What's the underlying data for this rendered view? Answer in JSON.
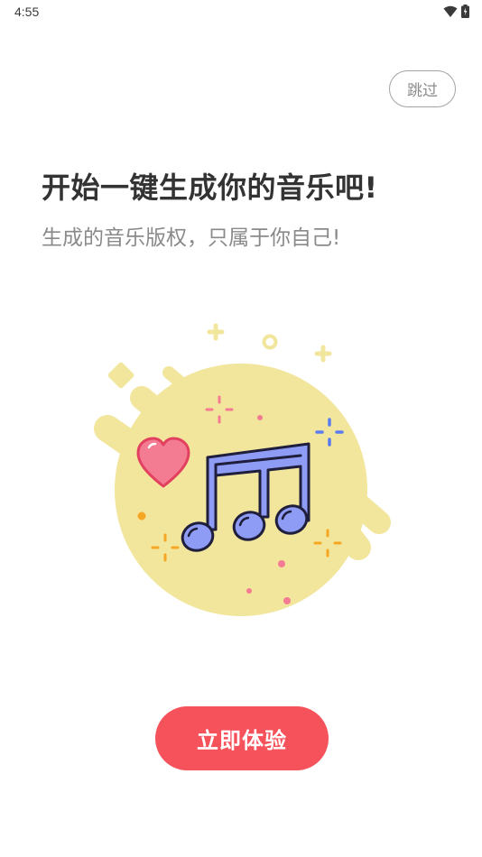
{
  "status_bar": {
    "time": "4:55",
    "icons": [
      "wifi-icon",
      "battery-icon"
    ]
  },
  "skip_button": {
    "label": "跳过"
  },
  "onboarding": {
    "headline": "开始一键生成你的音乐吧!",
    "subtitle": "生成的音乐版权，只属于你自己!"
  },
  "illustration": {
    "icon": "music-notes-icon",
    "decorations": [
      "heart-icon",
      "sparkle-icon"
    ]
  },
  "cta_button": {
    "label": "立即体验"
  },
  "colors": {
    "accent": "#f5525b",
    "blob": "#f2e59c",
    "note": "#8f9cf5",
    "heart": "#f47c92"
  }
}
